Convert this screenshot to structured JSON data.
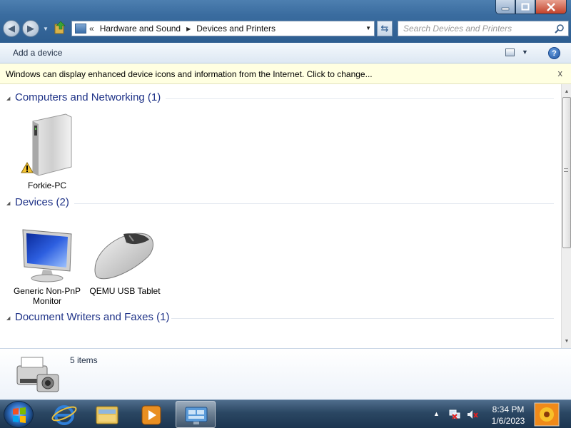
{
  "window": {
    "minimize_icon": "minimize-icon",
    "maximize_icon": "maximize-icon",
    "close_icon": "close-icon"
  },
  "address_bar": {
    "overflow": "«",
    "crumbs": [
      "Hardware and Sound",
      "Devices and Printers"
    ]
  },
  "search": {
    "placeholder": "Search Devices and Printers"
  },
  "toolbar": {
    "add_device": "Add a device",
    "help": "?"
  },
  "infobar": {
    "message": "Windows can display enhanced device icons and information from the Internet. Click to change...",
    "close": "x"
  },
  "groups": [
    {
      "title": "Computers and Networking (1)",
      "items": [
        {
          "label": "Forkie-PC",
          "icon": "computer-icon",
          "warning": true
        }
      ]
    },
    {
      "title": "Devices (2)",
      "items": [
        {
          "label": "Generic Non-PnP Monitor",
          "icon": "monitor-icon"
        },
        {
          "label": "QEMU USB Tablet",
          "icon": "mouse-icon"
        }
      ]
    },
    {
      "title": "Document Writers and Faxes (1)",
      "items": []
    }
  ],
  "details": {
    "count": "5 items"
  },
  "taskbar": {
    "time": "8:34 PM",
    "date": "1/6/2023",
    "tray_arrow": "▲"
  },
  "colors": {
    "group_title": "#1e3287",
    "infobar_bg": "#ffffe1",
    "taskbar": "#2b4763"
  }
}
